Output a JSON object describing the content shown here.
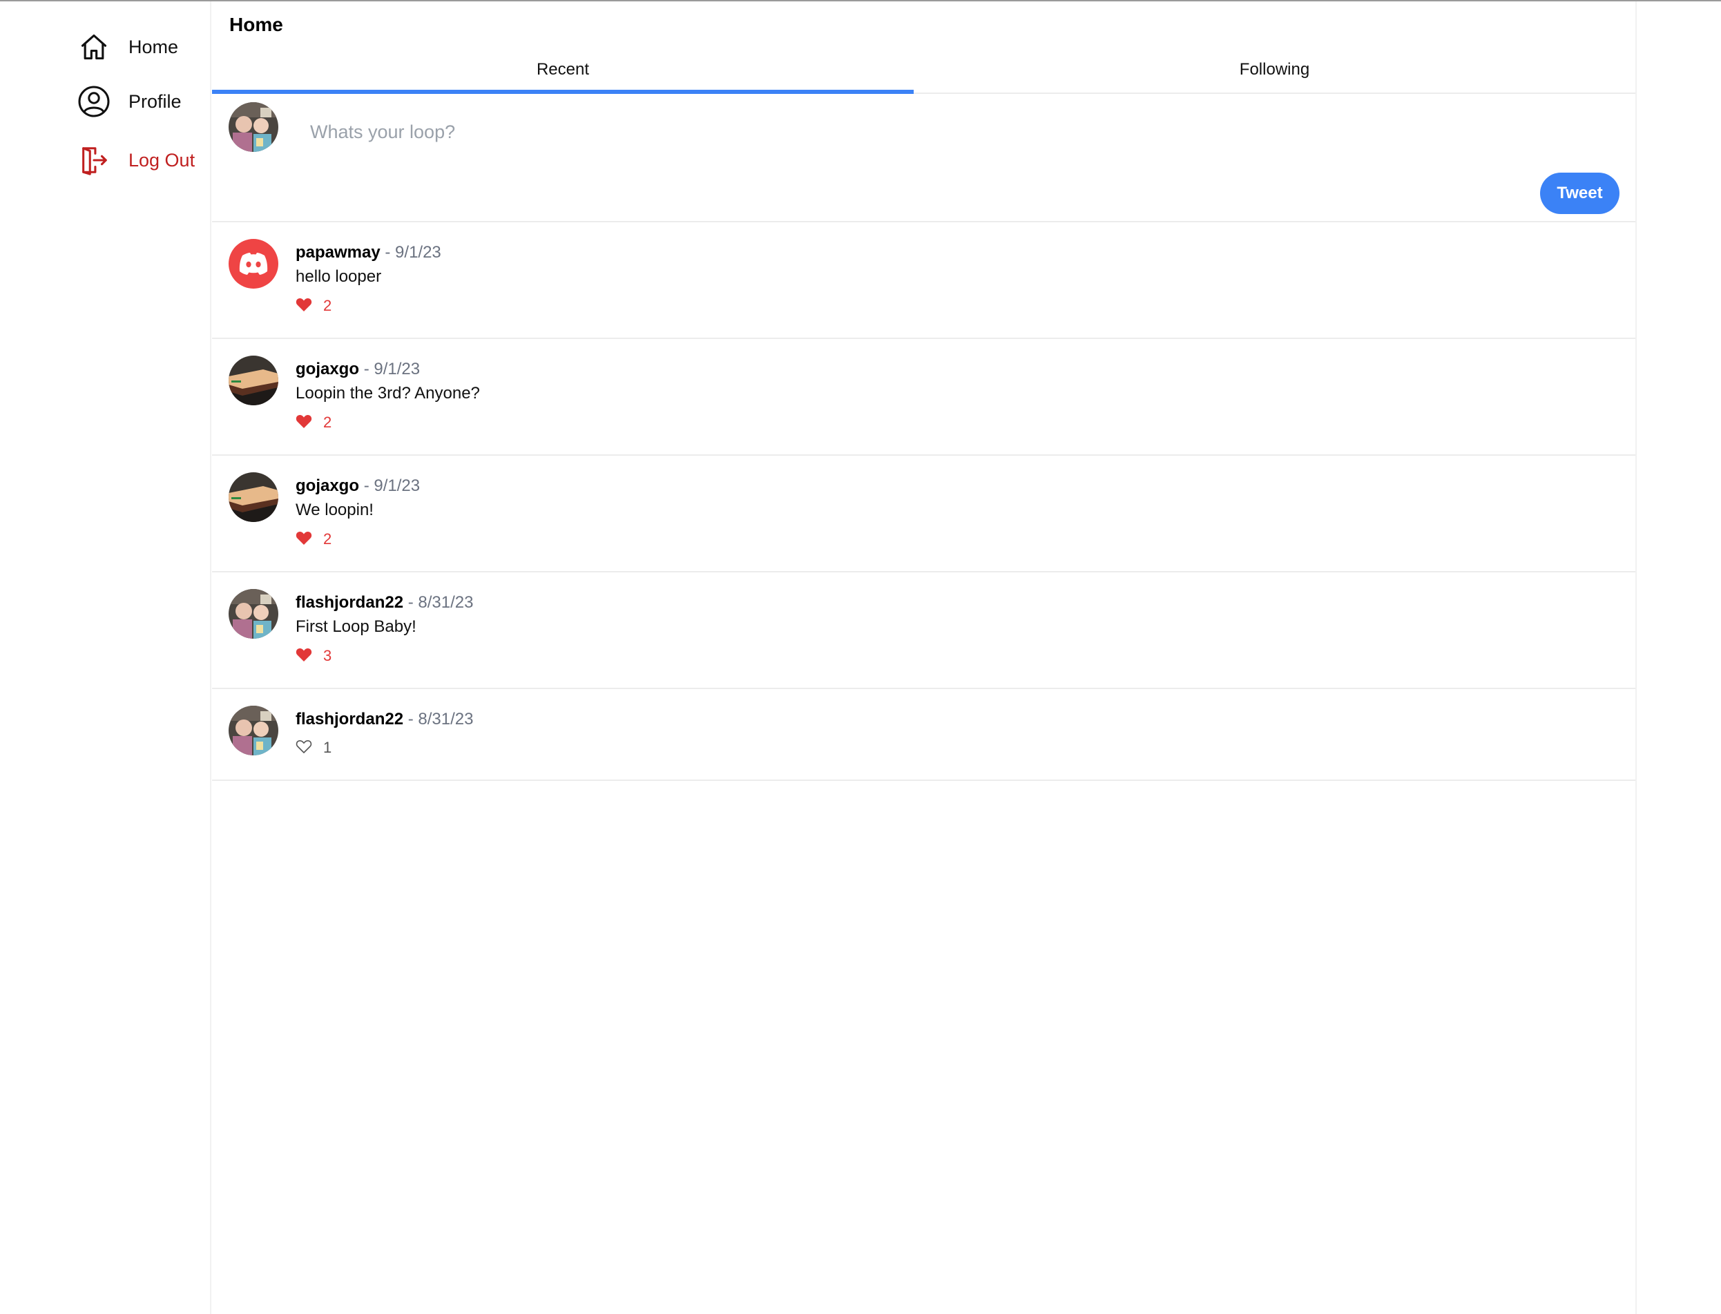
{
  "sidebar": {
    "items": [
      {
        "label": "Home",
        "icon": "home-icon"
      },
      {
        "label": "Profile",
        "icon": "user-circle-icon"
      },
      {
        "label": "Log Out",
        "icon": "logout-icon",
        "color": "#c02020"
      }
    ]
  },
  "header": {
    "title": "Home"
  },
  "tabs": {
    "recent": "Recent",
    "following": "Following",
    "active": "Recent",
    "accent": "#3b82f6"
  },
  "composer": {
    "placeholder": "Whats your loop?",
    "button": "Tweet"
  },
  "posts": [
    {
      "username": "papawmay",
      "date": "- 9/1/23",
      "text": "hello looper",
      "likes": "2",
      "liked": true,
      "avatar": "discord-avatar"
    },
    {
      "username": "gojaxgo",
      "date": "- 9/1/23",
      "text": "Loopin the 3rd? Anyone?",
      "likes": "2",
      "liked": true,
      "avatar": "photo-avatar"
    },
    {
      "username": "gojaxgo",
      "date": "- 9/1/23",
      "text": "We loopin!",
      "likes": "2",
      "liked": true,
      "avatar": "photo-avatar"
    },
    {
      "username": "flashjordan22",
      "date": "- 8/31/23",
      "text": "First Loop Baby!",
      "likes": "3",
      "liked": true,
      "avatar": "photo-avatar"
    },
    {
      "username": "flashjordan22",
      "date": "- 8/31/23",
      "text": "",
      "likes": "1",
      "liked": false,
      "avatar": "photo-avatar"
    }
  ],
  "colors": {
    "like": "#e23838",
    "logout": "#c02020",
    "discord_avatar_bg": "#ef4444"
  }
}
